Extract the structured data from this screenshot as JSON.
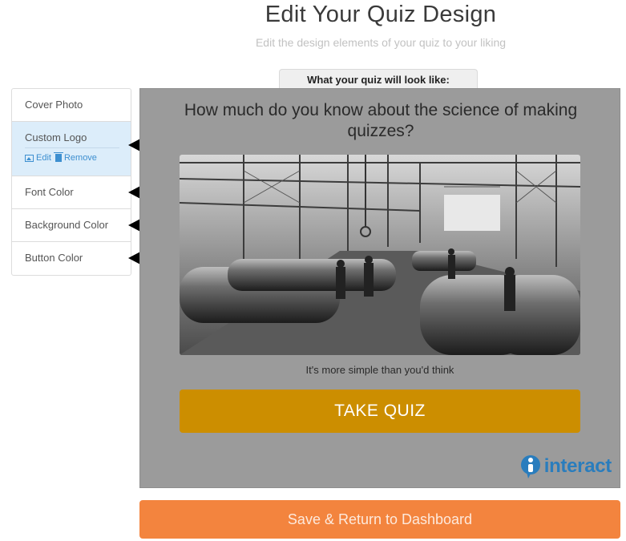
{
  "header": {
    "title": "Edit Your Quiz Design",
    "subtitle": "Edit the design elements of your quiz to your liking"
  },
  "preview_tab": {
    "label": "What your quiz will look like:"
  },
  "sidebar": {
    "items": [
      {
        "label": "Cover Photo"
      },
      {
        "label": "Custom Logo",
        "active": true,
        "actions": {
          "edit": "Edit",
          "remove": "Remove"
        }
      },
      {
        "label": "Font Color"
      },
      {
        "label": "Background Color"
      },
      {
        "label": "Button Color"
      }
    ]
  },
  "quiz": {
    "question": "How much do you know about the science of making quizzes?",
    "tagline": "It's more simple than you'd think",
    "button_label": "TAKE QUIZ",
    "brand_logo": "interact",
    "background_color": "#9b9b9b",
    "button_color": "#cc8e00",
    "brand_color": "#2a7dbd"
  },
  "footer": {
    "save_label": "Save & Return to Dashboard",
    "save_color": "#f3843e"
  }
}
